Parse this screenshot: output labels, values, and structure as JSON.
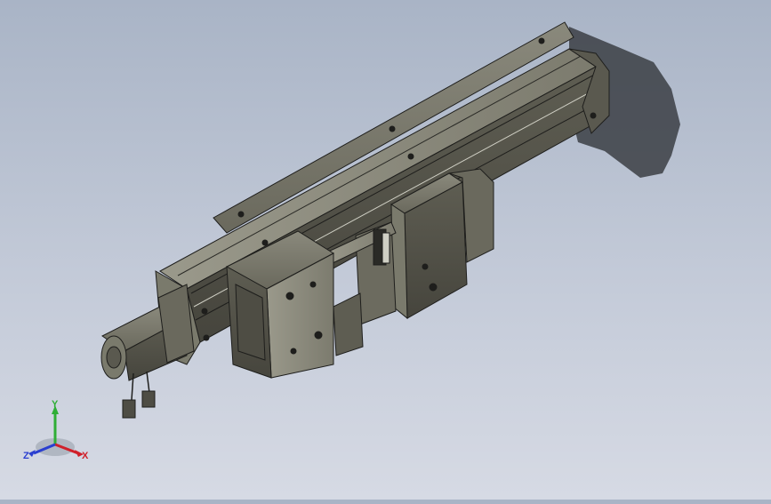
{
  "viewport": {
    "background_top": "#a9b4c6",
    "background_bottom": "#d6dae4"
  },
  "model": {
    "body_color": "#6f6e62",
    "edge_color": "#1e1e1c",
    "shadow_color": "#3b3e44"
  },
  "triad": {
    "x_label": "X",
    "y_label": "Y",
    "z_label": "Z",
    "x_color": "#d0202a",
    "y_color": "#2fae36",
    "z_color": "#2a3fd0"
  }
}
